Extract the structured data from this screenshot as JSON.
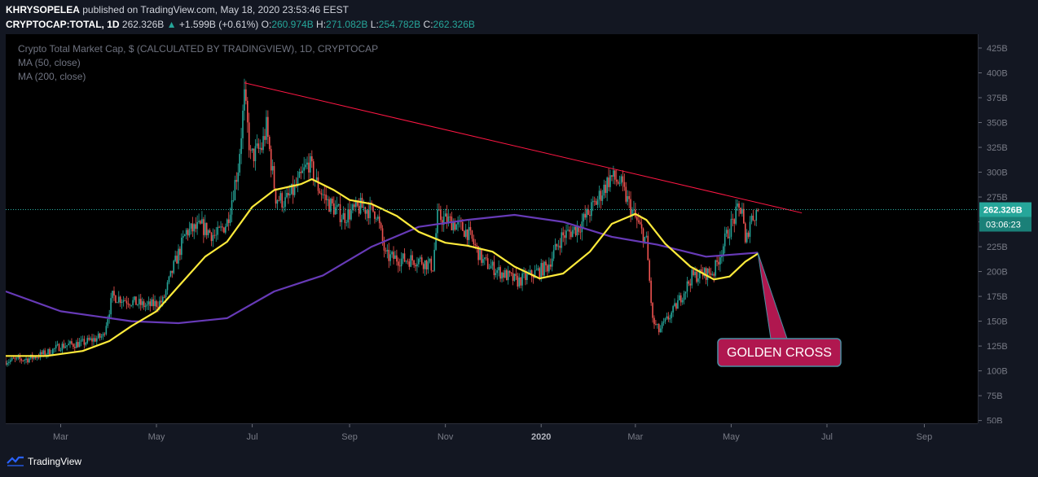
{
  "header": {
    "author": "KHRYSOPELEA",
    "published_text": "published on TradingView.com, May 18, 2020 23:53:46 EEST",
    "symbol": "CRYPTOCAP:TOTAL, 1D",
    "last": "262.326B",
    "change": "+1.599B (+0.61%)",
    "open_label": "O:",
    "open": "260.974B",
    "high_label": "H:",
    "high": "271.082B",
    "low_label": "L:",
    "low": "254.782B",
    "close_label": "C:",
    "close": "262.326B"
  },
  "legend": {
    "title": "Crypto Total Market Cap, $ (CALCULATED BY TRADINGVIEW), 1D, CRYPTOCAP",
    "ma50": "MA (50, close)",
    "ma200": "MA (200, close)"
  },
  "price_tags": {
    "last": "262.326B",
    "countdown": "03:06:23"
  },
  "annotation": {
    "text": "GOLDEN CROSS"
  },
  "footer": {
    "brand": "TradingView"
  },
  "colors": {
    "up": "#26a69a",
    "down": "#ef5350",
    "ma50": "#ffeb3b",
    "ma200": "#673ab7",
    "trendline": "#ff1744",
    "callout": "#b0174f",
    "background": "#000000"
  },
  "chart_data": {
    "type": "candlestick",
    "title": "Crypto Total Market Cap, $ (CALCULATED BY TRADINGVIEW), 1D, CRYPTOCAP",
    "ylim": [
      50,
      425
    ],
    "y_ticks": [
      "425B",
      "400B",
      "375B",
      "350B",
      "325B",
      "300B",
      "275B",
      "250B",
      "225B",
      "200B",
      "175B",
      "150B",
      "125B",
      "100B",
      "75B",
      "50B"
    ],
    "x_ticks": [
      "Mar",
      "May",
      "Jul",
      "Sep",
      "Nov",
      "2020",
      "Mar",
      "May",
      "Jul",
      "Sep"
    ],
    "x_range": [
      "2019-01-25",
      "2020-10-05"
    ],
    "last_value": 262.326,
    "price_path": [
      [
        "2019-01-25",
        110
      ],
      [
        "2019-02-08",
        112
      ],
      [
        "2019-02-20",
        118
      ],
      [
        "2019-03-01",
        125
      ],
      [
        "2019-03-15",
        128
      ],
      [
        "2019-03-28",
        135
      ],
      [
        "2019-04-03",
        175
      ],
      [
        "2019-04-15",
        170
      ],
      [
        "2019-04-25",
        165
      ],
      [
        "2019-05-05",
        170
      ],
      [
        "2019-05-12",
        205
      ],
      [
        "2019-05-20",
        240
      ],
      [
        "2019-05-30",
        245
      ],
      [
        "2019-06-08",
        235
      ],
      [
        "2019-06-15",
        250
      ],
      [
        "2019-06-22",
        305
      ],
      [
        "2019-06-26",
        375
      ],
      [
        "2019-06-30",
        315
      ],
      [
        "2019-07-07",
        325
      ],
      [
        "2019-07-10",
        345
      ],
      [
        "2019-07-16",
        275
      ],
      [
        "2019-07-22",
        270
      ],
      [
        "2019-07-29",
        285
      ],
      [
        "2019-08-06",
        310
      ],
      [
        "2019-08-12",
        285
      ],
      [
        "2019-08-18",
        270
      ],
      [
        "2019-08-28",
        255
      ],
      [
        "2019-09-08",
        265
      ],
      [
        "2019-09-18",
        260
      ],
      [
        "2019-09-24",
        215
      ],
      [
        "2019-10-05",
        212
      ],
      [
        "2019-10-15",
        212
      ],
      [
        "2019-10-24",
        205
      ],
      [
        "2019-10-27",
        255
      ],
      [
        "2019-11-05",
        250
      ],
      [
        "2019-11-15",
        240
      ],
      [
        "2019-11-25",
        210
      ],
      [
        "2019-12-05",
        200
      ],
      [
        "2019-12-17",
        190
      ],
      [
        "2019-12-25",
        196
      ],
      [
        "2020-01-05",
        205
      ],
      [
        "2020-01-14",
        235
      ],
      [
        "2020-01-25",
        245
      ],
      [
        "2020-02-05",
        270
      ],
      [
        "2020-02-14",
        295
      ],
      [
        "2020-02-20",
        290
      ],
      [
        "2020-02-28",
        260
      ],
      [
        "2020-03-08",
        230
      ],
      [
        "2020-03-12",
        150
      ],
      [
        "2020-03-16",
        140
      ],
      [
        "2020-03-25",
        160
      ],
      [
        "2020-04-06",
        195
      ],
      [
        "2020-04-20",
        200
      ],
      [
        "2020-04-29",
        240
      ],
      [
        "2020-05-05",
        260
      ],
      [
        "2020-05-08",
        265
      ],
      [
        "2020-05-10",
        225
      ],
      [
        "2020-05-13",
        252
      ],
      [
        "2020-05-18",
        262.3
      ]
    ],
    "ma50_path": [
      [
        "2019-01-25",
        115
      ],
      [
        "2019-02-20",
        115
      ],
      [
        "2019-03-15",
        120
      ],
      [
        "2019-04-01",
        130
      ],
      [
        "2019-04-15",
        145
      ],
      [
        "2019-05-01",
        160
      ],
      [
        "2019-05-15",
        185
      ],
      [
        "2019-06-01",
        215
      ],
      [
        "2019-06-15",
        230
      ],
      [
        "2019-07-01",
        265
      ],
      [
        "2019-07-15",
        282
      ],
      [
        "2019-08-01",
        288
      ],
      [
        "2019-08-08",
        293
      ],
      [
        "2019-08-22",
        282
      ],
      [
        "2019-09-01",
        272
      ],
      [
        "2019-09-15",
        268
      ],
      [
        "2019-10-01",
        256
      ],
      [
        "2019-10-15",
        240
      ],
      [
        "2019-11-01",
        229
      ],
      [
        "2019-11-15",
        226
      ],
      [
        "2019-12-01",
        220
      ],
      [
        "2019-12-15",
        205
      ],
      [
        "2019-12-31",
        193
      ],
      [
        "2020-01-15",
        198
      ],
      [
        "2020-02-01",
        220
      ],
      [
        "2020-02-15",
        248
      ],
      [
        "2020-03-01",
        258
      ],
      [
        "2020-03-08",
        252
      ],
      [
        "2020-03-20",
        228
      ],
      [
        "2020-04-05",
        205
      ],
      [
        "2020-04-20",
        192
      ],
      [
        "2020-04-30",
        195
      ],
      [
        "2020-05-10",
        210
      ],
      [
        "2020-05-18",
        218
      ]
    ],
    "ma200_path": [
      [
        "2019-01-25",
        180
      ],
      [
        "2019-03-01",
        160
      ],
      [
        "2019-04-15",
        150
      ],
      [
        "2019-05-15",
        148
      ],
      [
        "2019-06-15",
        153
      ],
      [
        "2019-07-15",
        180
      ],
      [
        "2019-08-15",
        196
      ],
      [
        "2019-09-15",
        225
      ],
      [
        "2019-10-15",
        245
      ],
      [
        "2019-11-15",
        252
      ],
      [
        "2019-12-15",
        257
      ],
      [
        "2020-01-15",
        250
      ],
      [
        "2020-02-15",
        235
      ],
      [
        "2020-03-15",
        227
      ],
      [
        "2020-04-15",
        215
      ],
      [
        "2020-05-18",
        219
      ]
    ],
    "trendline": [
      [
        "2019-06-26",
        390
      ],
      [
        "2020-06-15",
        259
      ]
    ],
    "golden_cross": {
      "date": "2020-05-18",
      "value": 219
    }
  }
}
